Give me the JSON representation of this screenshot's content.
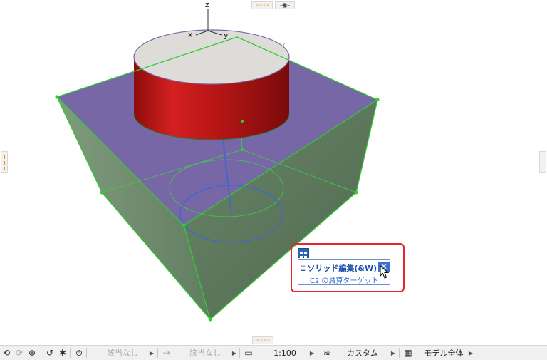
{
  "viewport": {
    "axis_labels": {
      "z": "z",
      "x": "x",
      "y": "y"
    },
    "colors": {
      "solid_top": "#7a6aa8",
      "solid_side": "#5f7a5e",
      "edge_highlight": "#33cc33",
      "cylinder": "#c01818",
      "cylinder_top": "#dedcd8",
      "trace_blue": "#4466cc"
    }
  },
  "popup": {
    "title": "ソリッド編集(&W)",
    "subtitle": "C2 の減算ターゲット",
    "close_symbol": "✕",
    "frame_color": "#e8242a"
  },
  "edge_tabs": {
    "top_dashes": "----",
    "bottom_dashes": "----"
  },
  "statusbar": {
    "undo_icon": "undo-icon",
    "redo_icon": "redo-icon",
    "zoom_icon": "zoom-in-icon",
    "orbit_icon": "orbit-icon",
    "walk_icon": "walk-icon",
    "fit_icon": "zoom-fit-icon",
    "view_value_1": "該当なし",
    "view_value_2": "該当なし",
    "scale": "1:100",
    "layer_combo": "カスタム",
    "model_view": "モデル全体"
  }
}
